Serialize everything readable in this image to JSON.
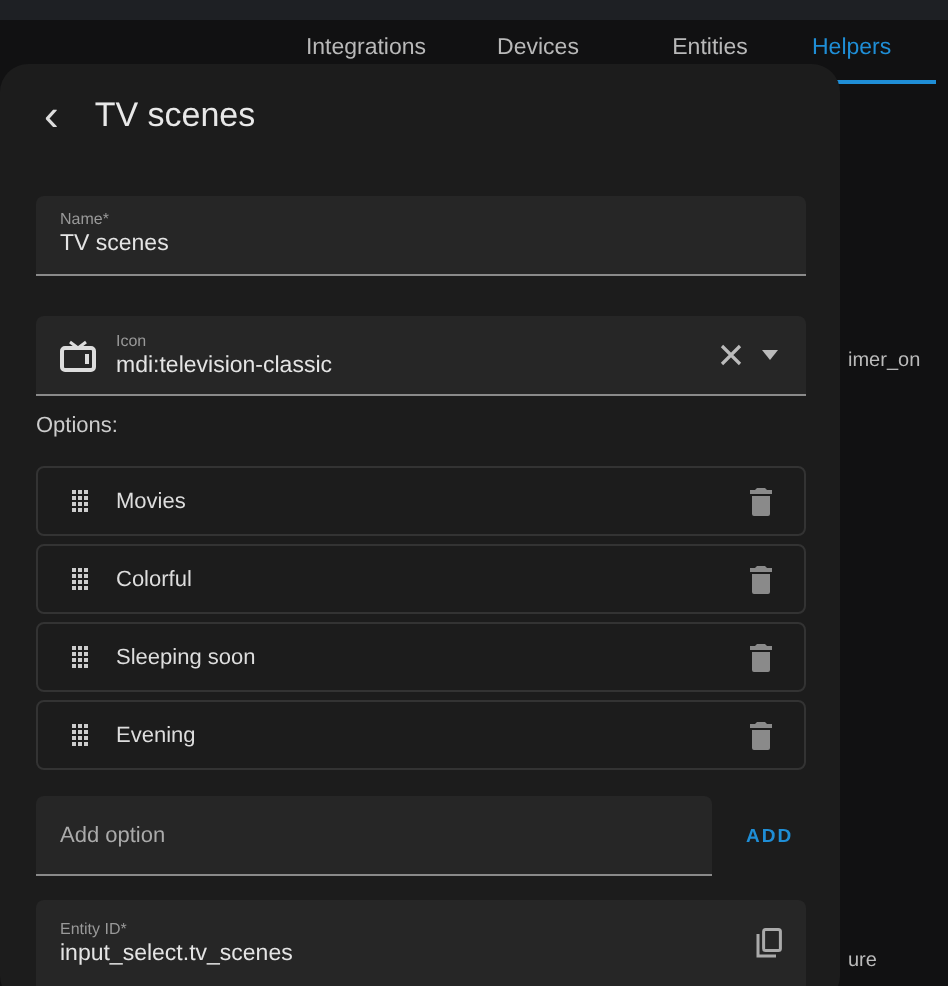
{
  "tabs": [
    {
      "label": "Integrations",
      "selected": false
    },
    {
      "label": "Devices",
      "selected": false
    },
    {
      "label": "Entities",
      "selected": false
    },
    {
      "label": "Helpers",
      "selected": true
    }
  ],
  "background_rows": [
    {
      "text": "imer_on"
    },
    {
      "text": "ure"
    }
  ],
  "dialog": {
    "back_icon": "‹",
    "title": "TV scenes",
    "name_field": {
      "label": "Name*",
      "value": "TV scenes"
    },
    "icon_field": {
      "label": "Icon",
      "value": "mdi:television-classic"
    },
    "options_label": "Options:",
    "options": [
      {
        "label": "Movies"
      },
      {
        "label": "Colorful"
      },
      {
        "label": "Sleeping soon"
      },
      {
        "label": "Evening"
      }
    ],
    "add_field": {
      "placeholder": "Add option"
    },
    "add_button": "ADD",
    "entity_field": {
      "label": "Entity ID*",
      "value": "input_select.tv_scenes"
    }
  }
}
